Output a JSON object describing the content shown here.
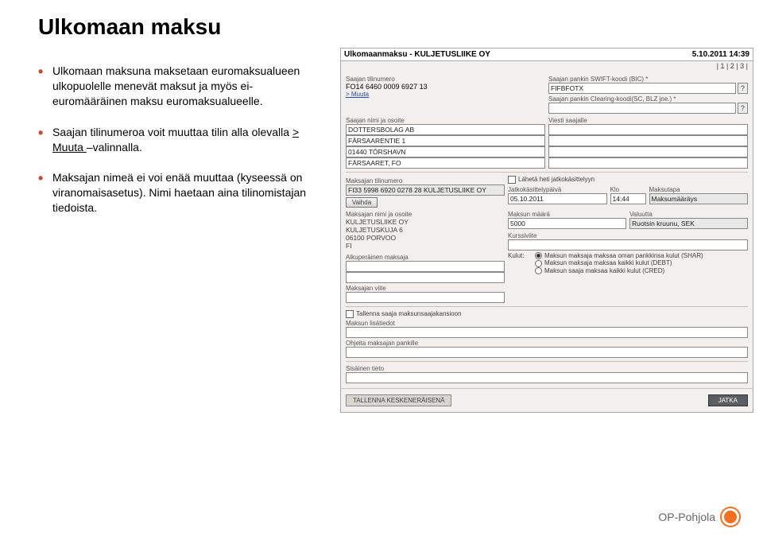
{
  "slide": {
    "title": "Ulkomaan maksu",
    "bullets": [
      "Ulkomaan maksuna maksetaan euromaksualueen ulkopuolelle menevät maksut ja myös ei-euromääräinen maksu euromaksualueelle.",
      "Saajan tilinumeroa voit muuttaa tilin alla olevalla ",
      "Maksajan nimeä ei voi enää muuttaa (kyseessä on viranomaisasetus). Nimi haetaan aina tilinomistajan tiedoista."
    ],
    "bullet2_link": "> Muuta ",
    "bullet2_tail": "–valinnalla."
  },
  "app": {
    "title": "Ulkomaanmaksu - KULJETUSLIIKE OY",
    "datetime": "5.10.2011 14:39",
    "pager": "| 1 | 2 | 3 |",
    "labels": {
      "payee_acct": "Saajan tilinumero",
      "payee_acct_val": "FO14 6460 0009 6927 13",
      "change": "> Muuta",
      "swift": "Saajan pankin SWIFT-koodi (BIC) *",
      "swift_val": "FIFBFOTX",
      "clearing": "Saajan pankin Clearing-koodi(SC, BLZ jne.) *",
      "clearing_val": "",
      "payee_name": "Saajan nimi ja osoite",
      "pn1": "DOTTERSBOLAG AB",
      "pn2": "FÄRSAARENTIE 1",
      "pn3": "01440 TÓRSHAVN",
      "pn4": "FÄRSAARET, FO",
      "msg": "Viesti saajalle",
      "payer_acct": "Maksajan tilinumero",
      "payer_acct_val": "FI33 5998 6920 0278 28 KULJETUSLIIKE OY",
      "vaihda": "Vaihda",
      "send_now": "Lähetä heti jatkokäsittelyyn",
      "batch_date": "Jatkokäsittelypäivä",
      "date_val": "05.10.2011",
      "klo": "Klo",
      "klo_val": "14:44",
      "ptype": "Maksutapa",
      "ptype_val": "Maksumääräys",
      "payer_name": "Maksajan nimi ja osoite",
      "pay1": "KULJETUSLIIKE OY",
      "pay2": "KULJETUSKUJA 6",
      "pay3": "06100 PORVOO",
      "pay4": "FI",
      "amount": "Maksun määrä",
      "amount_val": "5000",
      "currency": "Valuutta",
      "currency_val": "Ruotsin kruunu, SEK",
      "rateref": "Kurssiviite",
      "orig_payer": "Alkuperäinen maksaja",
      "fees": "Kulut:",
      "fee_shar": "Maksun maksaja maksaa oman pankkinsa kulut (SHAR)",
      "fee_debt": "Maksun maksaja maksaa kaikki kulut (DEBT)",
      "fee_cred": "Maksun saaja maksaa kaikki kulut (CRED)",
      "payer_ref": "Maksajan viite",
      "save_payee": "Tallenna saaja maksunsaajakansioon",
      "extra": "Maksun lisätiedot",
      "bank_instr": "Ohjeita maksajan pankille",
      "internal": "Sisäinen tieto",
      "save_draft": "TALLENNA KESKENERÄISENÄ",
      "continue": "JATKA"
    }
  },
  "brand": "OP-Pohjola"
}
